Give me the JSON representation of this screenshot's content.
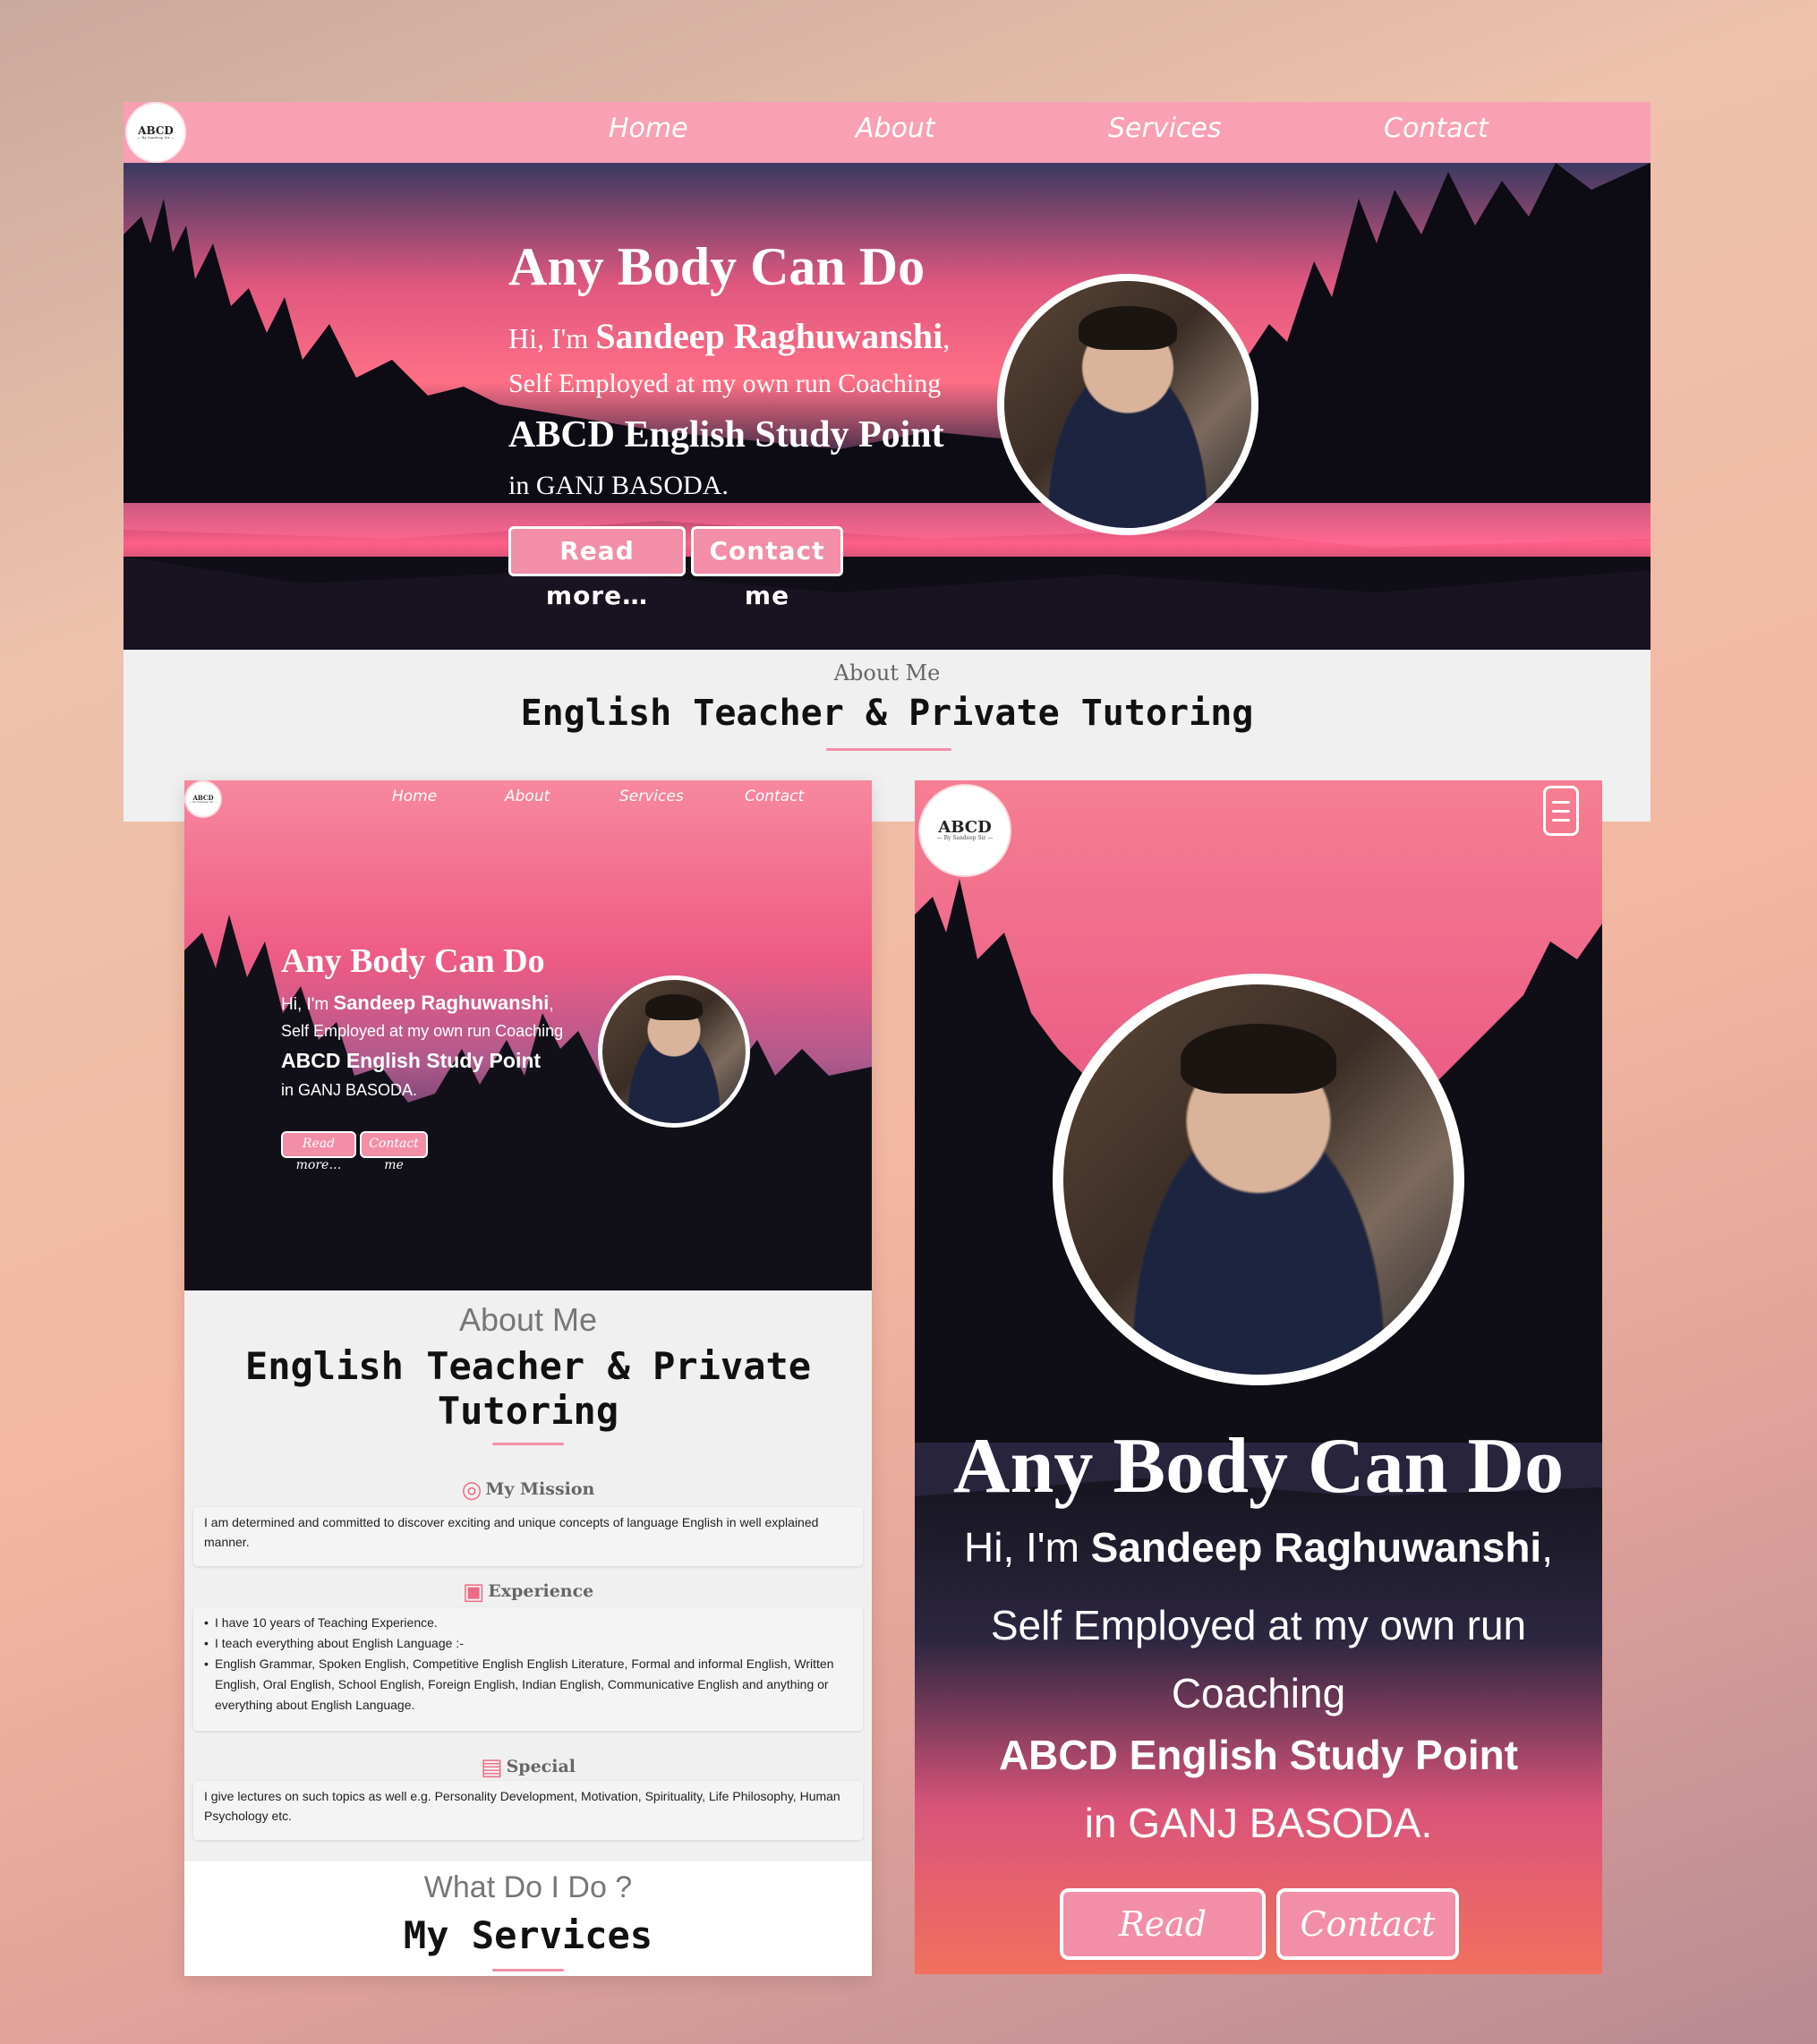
{
  "logo": {
    "title": "ABCD",
    "sub": "— By Sandeep Sir —"
  },
  "nav": {
    "home": "Home",
    "about": "About",
    "services": "Services",
    "contact": "Contact"
  },
  "hero": {
    "title": "Any Body Can Do",
    "greeting_pre": "Hi, I'm ",
    "name": "Sandeep Raghuwanshi",
    "name_suffix": ",",
    "line2": "Self Employed at my own run Coaching",
    "line2_a": "Self Employed at my own run",
    "line2_b": "Coaching",
    "school": "ABCD English Study Point",
    "location": "in GANJ BASODA.",
    "read_more": "Read more…",
    "contact_me": "Contact me"
  },
  "about": {
    "caption": "About Me",
    "title": "English Teacher & Private Tutoring",
    "title_a": "English Teacher & Private",
    "title_b": "Tutoring"
  },
  "mission": {
    "heading": "My Mission",
    "text": "I am determined and committed to discover exciting and unique concepts of language English in well explained manner."
  },
  "experience": {
    "heading": "Experience",
    "items": [
      "I have 10 years of Teaching Experience.",
      "I teach everything about English Language :-",
      "English Grammar, Spoken English, Competitive English English Literature, Formal and informal English, Written English, Oral English, School English, Foreign English, Indian English, Communicative English and anything or everything about English Language."
    ]
  },
  "special": {
    "heading": "Special",
    "text": "I give lectures on such topics as well e.g. Personality Development, Motivation, Spirituality, Life Philosophy, Human Psychology etc."
  },
  "services": {
    "caption": "What Do I Do ?",
    "title": "My Services"
  },
  "icons": {
    "menu": "hamburger-menu-icon",
    "mission": "target-icon",
    "experience": "briefcase-icon",
    "special": "book-icon"
  },
  "colors": {
    "accent": "#f28ea8",
    "navbar": "#f9a0b4"
  }
}
